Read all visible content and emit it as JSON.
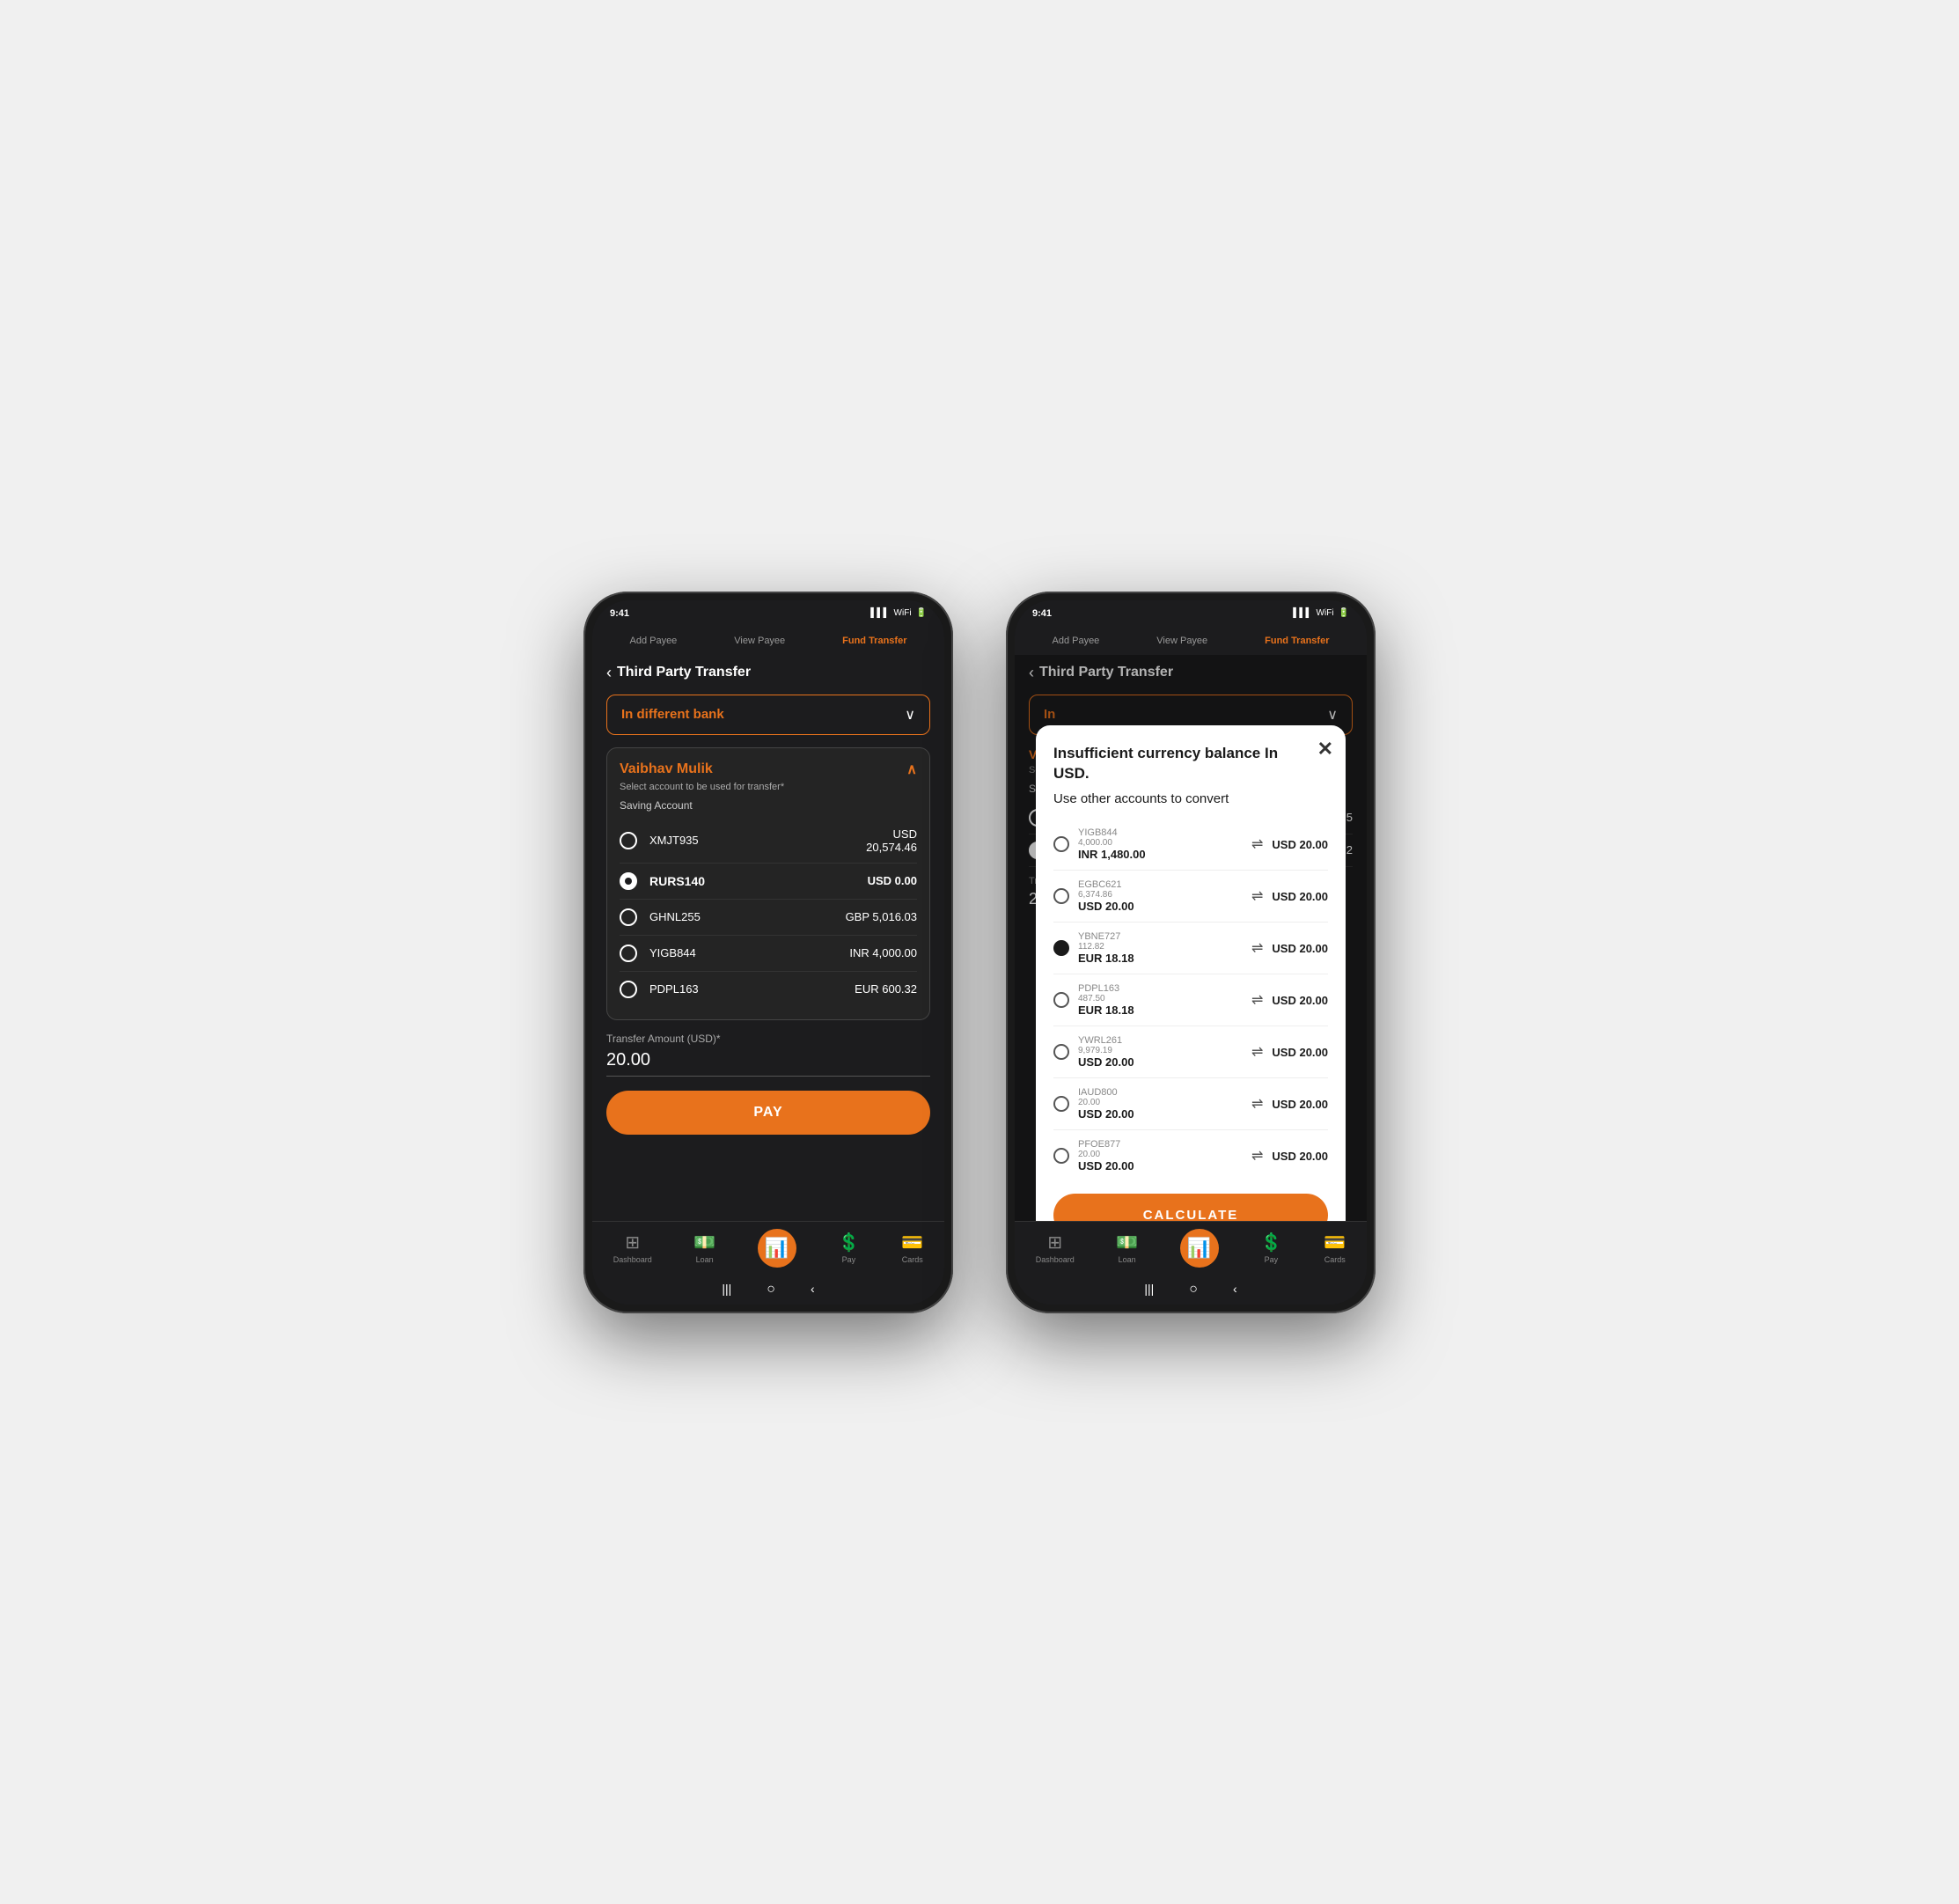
{
  "phone1": {
    "nav": {
      "add_payee": "Add Payee",
      "view_payee": "View Payee",
      "fund_transfer": "Fund Transfer"
    },
    "breadcrumb": "Third Party Transfer",
    "bank_selector": "In different bank",
    "account_owner": "Vaibhav Mulik",
    "account_subtitle": "Select account to be used for transfer*",
    "account_type": "Saving Account",
    "accounts": [
      {
        "id": "XMJT935",
        "currency": "USD",
        "amount": "20,574.46",
        "selected": false
      },
      {
        "id": "RURS140",
        "currency": "USD",
        "amount": "0.00",
        "selected": true
      },
      {
        "id": "GHNL255",
        "currency": "GBP",
        "amount": "5,016.03",
        "selected": false
      },
      {
        "id": "YIGB844",
        "currency": "INR",
        "amount": "4,000.00",
        "selected": false
      },
      {
        "id": "PDPL163",
        "currency": "EUR",
        "amount": "600.32",
        "selected": false
      }
    ],
    "transfer_label": "Transfer Amount (USD)*",
    "transfer_amount": "20.00",
    "pay_button": "PAY",
    "bottom_nav": [
      {
        "label": "Dashboard",
        "icon": "⊞"
      },
      {
        "label": "Loan",
        "icon": "💳"
      },
      {
        "label": "Pay",
        "icon": "📊",
        "active": true
      },
      {
        "label": "Pay",
        "icon": "$",
        "circle": true
      },
      {
        "label": "Cards",
        "icon": "💳"
      }
    ]
  },
  "phone2": {
    "nav": {
      "add_payee": "Add Payee",
      "view_payee": "View Payee",
      "fund_transfer": "Fund Transfer"
    },
    "breadcrumb": "Third Party Transfer",
    "bank_selector": "In",
    "modal": {
      "title": "Insufficient currency balance In USD.",
      "subtitle": "Use other accounts to convert",
      "close_icon": "✕",
      "accounts": [
        {
          "id": "YIGB844",
          "sub_amount": "4,000.00",
          "from_currency": "INR 1,480.00",
          "to_amount": "USD 20.00",
          "selected": false
        },
        {
          "id": "EGBC621",
          "sub_amount": "6,374.86",
          "from_currency": "USD 20.00",
          "to_amount": "USD 20.00",
          "selected": false
        },
        {
          "id": "YBNE727",
          "sub_amount": "112.82",
          "from_currency": "EUR 18.18",
          "to_amount": "USD 20.00",
          "selected": true
        },
        {
          "id": "PDPL163",
          "sub_amount": "487.50",
          "from_currency": "EUR 18.18",
          "to_amount": "USD 20.00",
          "selected": false
        },
        {
          "id": "YWRL261",
          "sub_amount": "9,979.19",
          "from_currency": "USD 20.00",
          "to_amount": "USD 20.00",
          "selected": false
        },
        {
          "id": "IAUD800",
          "sub_amount": "20.00",
          "from_currency": "USD 20.00",
          "to_amount": "USD 20.00",
          "selected": false
        },
        {
          "id": "PFOE877",
          "sub_amount": "20.00",
          "from_currency": "USD 20.00",
          "to_amount": "USD 20.00",
          "selected": false
        }
      ],
      "calculate_button": "CALCULATE"
    },
    "bottom_nav": [
      {
        "label": "Dashboard",
        "icon": "⊞"
      },
      {
        "label": "Loan",
        "icon": "💳"
      },
      {
        "label": "Pay",
        "icon": "📊",
        "active": true
      },
      {
        "label": "Pay",
        "icon": "$",
        "circle": true
      },
      {
        "label": "Cards",
        "icon": "💳"
      }
    ]
  }
}
